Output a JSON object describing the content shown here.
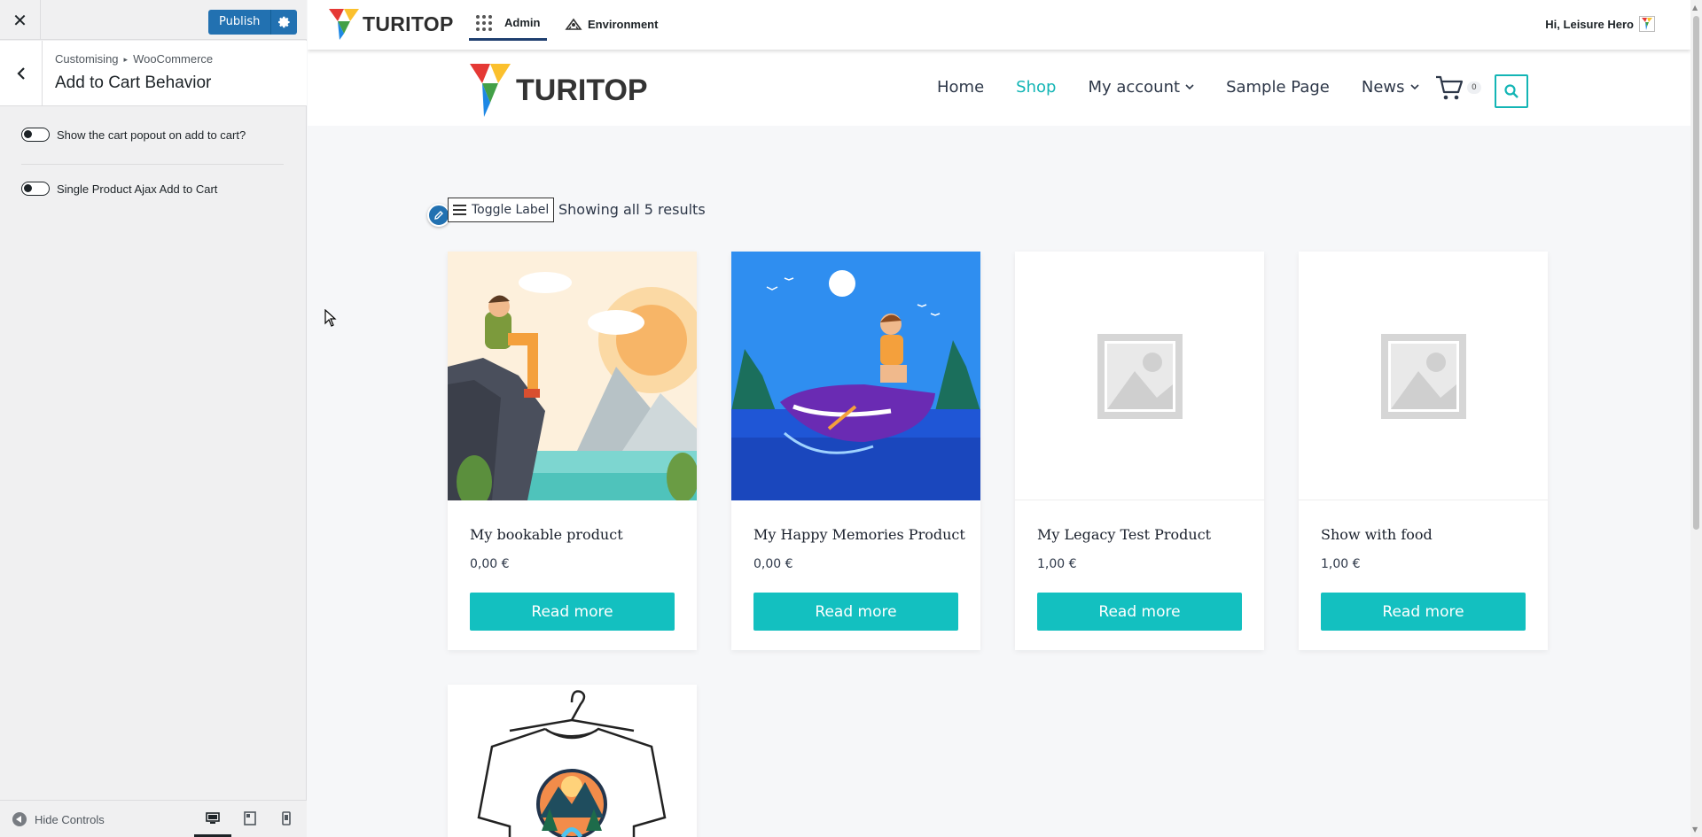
{
  "customizer": {
    "close_icon": "close-icon",
    "publish_label": "Publish",
    "breadcrumb": [
      "Customising",
      "WooCommerce"
    ],
    "breadcrumb_separator": "▸",
    "section_title": "Add to Cart Behavior",
    "options": [
      {
        "label": "Show the cart popout on add to cart?",
        "enabled": false
      },
      {
        "label": "Single Product Ajax Add to Cart",
        "enabled": false
      }
    ],
    "hide_controls_label": "Hide Controls",
    "devices": [
      "desktop-icon",
      "tablet-icon",
      "mobile-icon"
    ],
    "active_device": "desktop"
  },
  "adminbar": {
    "brand": "TURITOP",
    "admin_label": "Admin",
    "environment_label": "Environment",
    "greeting": "Hi, Leisure Hero"
  },
  "site": {
    "brand": "TURITOP",
    "nav": [
      {
        "label": "Home",
        "active": false,
        "dropdown": false
      },
      {
        "label": "Shop",
        "active": true,
        "dropdown": false
      },
      {
        "label": "My account",
        "active": false,
        "dropdown": true
      },
      {
        "label": "Sample Page",
        "active": false,
        "dropdown": false
      },
      {
        "label": "News",
        "active": false,
        "dropdown": true
      }
    ],
    "cart_count": "0",
    "accent_color": "#13c0c0"
  },
  "shop": {
    "toggle_label": "Toggle Label",
    "results_text": "Showing all 5 results",
    "products": [
      {
        "name": "My bookable product",
        "price": "0,00 €",
        "button": "Read more",
        "image": "hiker-illustration"
      },
      {
        "name": "My Happy Memories Product",
        "price": "0,00 €",
        "button": "Read more",
        "image": "jetski-illustration"
      },
      {
        "name": "My Legacy Test Product",
        "price": "1,00 €",
        "button": "Read more",
        "image": "placeholder-image"
      },
      {
        "name": "Show with food",
        "price": "1,00 €",
        "button": "Read more",
        "image": "placeholder-image"
      }
    ],
    "partial_product_image": "tshirt-illustration"
  }
}
